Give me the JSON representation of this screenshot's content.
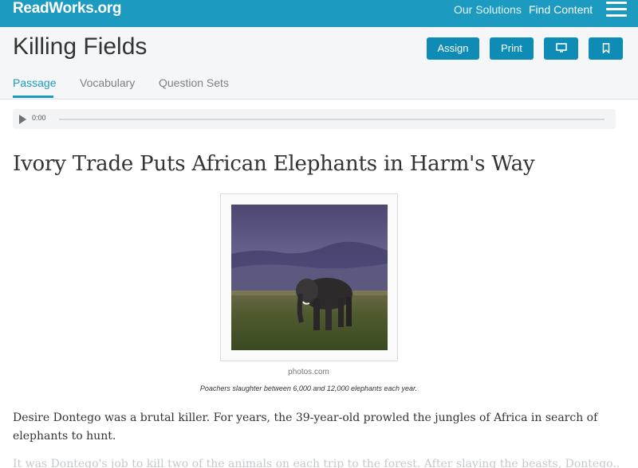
{
  "topbar": {
    "logo": "ReadWorks.org",
    "nav": {
      "solutions": "Our Solutions",
      "find_content": "Find Content"
    },
    "menu_icon": "hamburger-menu-icon"
  },
  "header": {
    "title": "Killing Fields",
    "buttons": {
      "assign": "Assign",
      "print": "Print",
      "projector_icon": "monitor-icon",
      "bookmark_icon": "bookmark-icon"
    },
    "tabs": [
      "Passage",
      "Vocabulary",
      "Question Sets"
    ],
    "active_tab": "Passage"
  },
  "audio": {
    "time": "0:00",
    "icon": "play-icon"
  },
  "article": {
    "title": "Ivory Trade Puts African Elephants in Harm's Way",
    "image_credit": "photos.com",
    "caption": "Poachers slaughter between 6,000 and 12,000 elephants each year.",
    "paragraphs": [
      "Desire Dontego was a brutal killer. For years, the 39-year-old prowled the jungles of Africa in search of elephants to hunt.",
      "It was Dontego's job to kill two of the animals on each trip to the forest. After slaying the beasts, Dontego..."
    ]
  },
  "colors": {
    "brand": "#1c9ac0",
    "button": "#0f8cb5",
    "header_bg": "#f4f6f7"
  }
}
